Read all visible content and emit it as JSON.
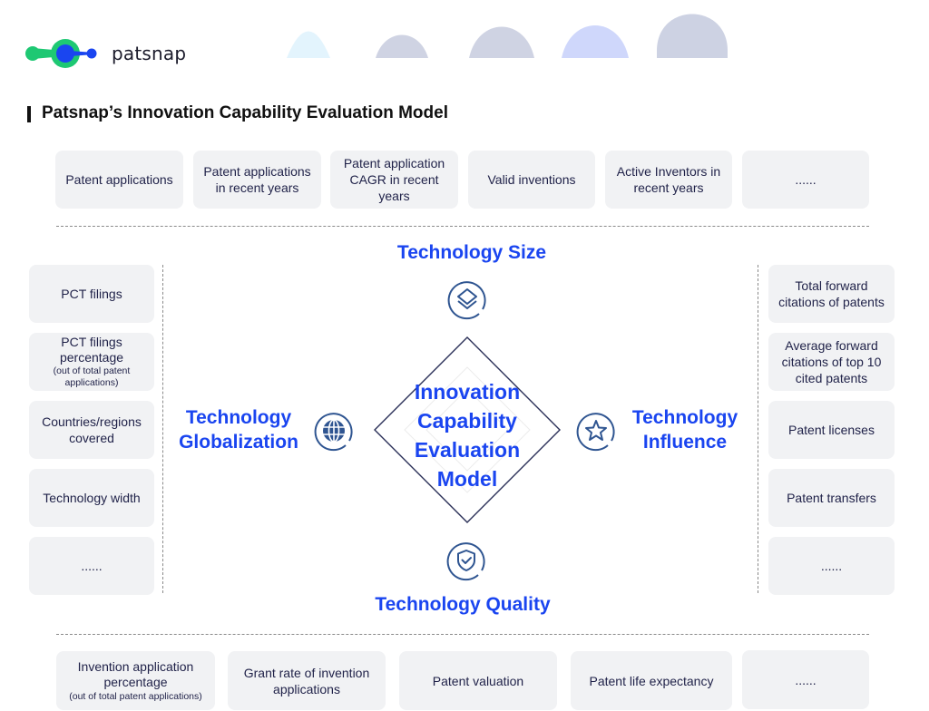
{
  "brand": {
    "name": "patsnap",
    "colors": {
      "green": "#1ec873",
      "blue": "#1a45f0"
    }
  },
  "page_title": "Patsnap’s Innovation Capability Evaluation Model",
  "center_model": {
    "lines": [
      "Innovation",
      "Capability",
      "Evaluation",
      "Model"
    ]
  },
  "dimensions": {
    "size": {
      "label": "Technology Size",
      "icon": "layers-icon"
    },
    "globalization": {
      "line1": "Technology",
      "line2": "Globalization",
      "icon": "globe-icon"
    },
    "influence": {
      "line1": "Technology",
      "line2": "Influence",
      "icon": "star-icon"
    },
    "quality": {
      "label": "Technology Quality",
      "icon": "shield-check-icon"
    }
  },
  "size_metrics": [
    {
      "text": "Patent applications"
    },
    {
      "text": "Patent applications in recent years"
    },
    {
      "text": "Patent application CAGR in recent years"
    },
    {
      "text": "Valid inventions"
    },
    {
      "text": "Active Inventors in recent years"
    },
    {
      "text": "......"
    }
  ],
  "globalization_metrics": [
    {
      "text": "PCT filings",
      "note": ""
    },
    {
      "text": "PCT filings percentage",
      "note": "(out of total patent applications)"
    },
    {
      "text": "Countries/regions covered",
      "note": ""
    },
    {
      "text": "Technology width",
      "note": ""
    },
    {
      "text": "......",
      "note": ""
    }
  ],
  "influence_metrics": [
    {
      "text": "Total forward citations of patents"
    },
    {
      "text": "Average forward citations of top 10 cited patents"
    },
    {
      "text": "Patent licenses"
    },
    {
      "text": "Patent transfers"
    },
    {
      "text": "......"
    }
  ],
  "quality_metrics": [
    {
      "text": "Invention application percentage",
      "note": "(out of total patent applications)"
    },
    {
      "text": "Grant rate of invention applications",
      "note": ""
    },
    {
      "text": "Patent valuation",
      "note": ""
    },
    {
      "text": "Patent life expectancy",
      "note": ""
    },
    {
      "text": "......",
      "note": ""
    }
  ]
}
